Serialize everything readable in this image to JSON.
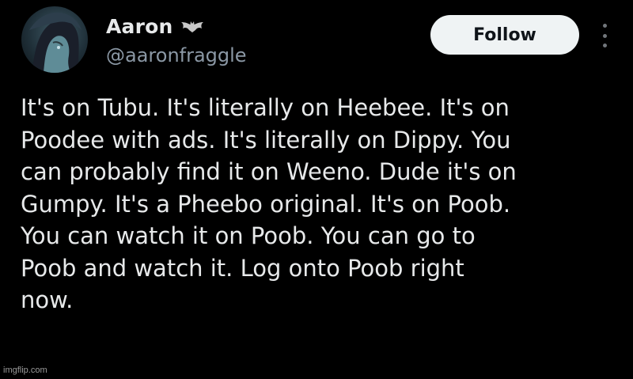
{
  "author": {
    "display_name": "Aaron",
    "handle": "@aaronfraggle",
    "avatar_icon": "avatar-icon",
    "badge_icon": "bat-icon"
  },
  "actions": {
    "follow_label": "Follow",
    "more_icon": "more-vertical-icon"
  },
  "tweet": {
    "text": "It's on Tubu. It's literally on Heebee. It's on\nPoodee with ads. It's literally on Dippy. You\ncan probably find it on Weeno. Dude it's on\nGumpy. It's a Pheebo original. It's on Poob.\nYou can watch it on Poob. You can go to\nPoob and watch it. Log onto Poob right\nnow."
  },
  "watermark": "imgflip.com",
  "colors": {
    "background": "#000000",
    "primary_text": "#e7e9ea",
    "secondary_text": "#8b98a5",
    "follow_bg": "#eff3f4",
    "follow_text": "#0f1419"
  }
}
